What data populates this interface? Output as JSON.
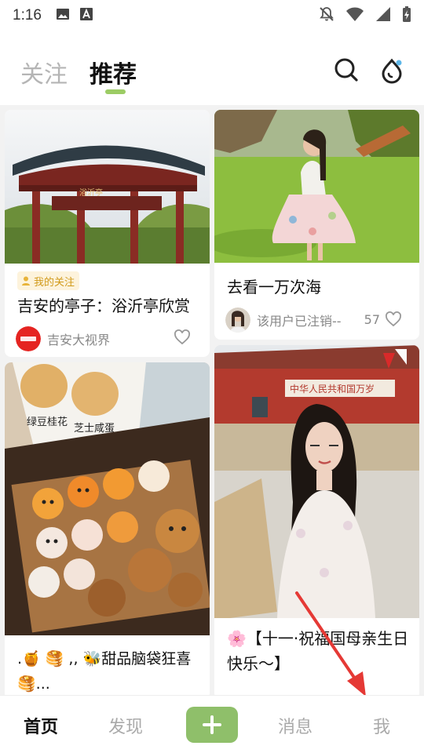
{
  "status_bar": {
    "time": "1:16",
    "icons": [
      "image-icon",
      "font-icon",
      "notifications-off-icon",
      "wifi-icon",
      "signal-icon",
      "battery-charging-icon"
    ]
  },
  "header": {
    "tabs": [
      {
        "label": "关注",
        "active": false
      },
      {
        "label": "推荐",
        "active": true
      }
    ],
    "icons": [
      "search-icon",
      "drop-icon"
    ],
    "accent_color": "#9ccc65"
  },
  "feed": {
    "cards": [
      {
        "tag": "我的关注",
        "title": "吉安的亭子：浴沂亭欣赏",
        "image_label": "浴沂亭",
        "author": "吉安大视界",
        "likes": ""
      },
      {
        "title": "去看一万次海",
        "author": "该用户已注销--",
        "likes": "57"
      },
      {
        "title": ".🍯 🥞 ,, 🐝甜品脑袋狂喜🥞...",
        "image_labels": [
          "绿豆桂花",
          "芝士咸蛋"
        ]
      },
      {
        "title": "🌸【十一·祝福国母亲生日快乐～】",
        "image_label": "中华人民共和国万岁"
      }
    ]
  },
  "bottom_nav": {
    "items": [
      {
        "label": "首页",
        "active": true
      },
      {
        "label": "发现",
        "active": false
      },
      {
        "label": "消息",
        "active": false
      },
      {
        "label": "我",
        "active": false
      }
    ],
    "add_color": "#8fbf6a"
  }
}
